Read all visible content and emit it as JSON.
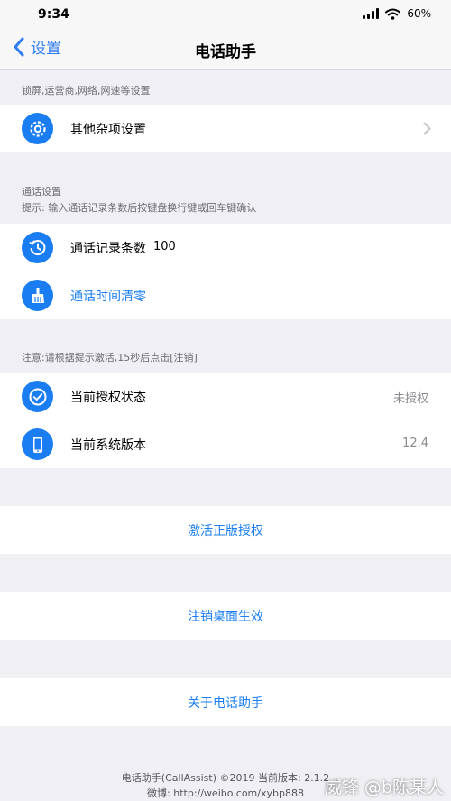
{
  "status_bar": {
    "time": "9:34",
    "battery": "60%"
  },
  "nav": {
    "back_label": "设置",
    "title": "电话助手"
  },
  "sections": {
    "misc": {
      "header": "锁屏,运营商,网络,网速等设置",
      "items": [
        {
          "label": "其他杂项设置",
          "icon": "gear-icon"
        }
      ]
    },
    "call": {
      "header": "通话设置",
      "hint": "提示: 输入通话记录条数后按键盘换行键或回车键确认",
      "items": [
        {
          "label": "通话记录条数",
          "value": "100",
          "icon": "history-icon"
        },
        {
          "label": "通话时间清零",
          "icon": "broom-icon"
        }
      ]
    },
    "license": {
      "header": "注意:请根据提示激活,15秒后点击[注销]",
      "items": [
        {
          "label": "当前授权状态",
          "detail": "未授权",
          "icon": "check-circle-icon"
        },
        {
          "label": "当前系统版本",
          "detail": "12.4",
          "icon": "phone-icon"
        }
      ]
    }
  },
  "actions": {
    "activate": "激活正版授权",
    "logout": "注销桌面生效",
    "about": "关于电话助手"
  },
  "footer": {
    "line1": "电话助手(CallAssist) ©2019 当前版本: 2.1.2",
    "line2": "微博: http://weibo.com/xybp888"
  },
  "watermark": "威锋 @b陈某人",
  "colors": {
    "accent": "#1a7ef2",
    "background": "#efeff4"
  }
}
